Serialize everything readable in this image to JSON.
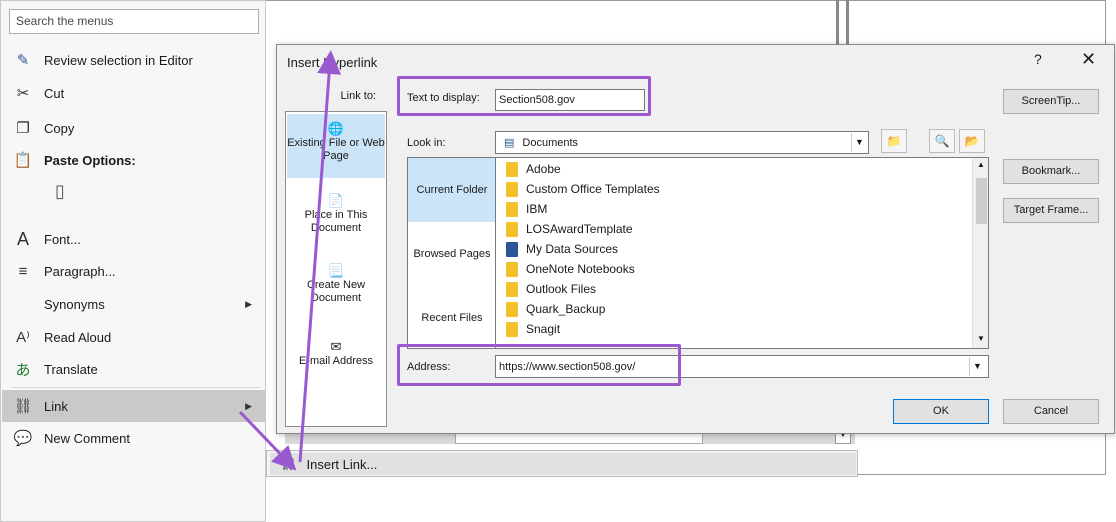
{
  "context_menu": {
    "search_placeholder": "Search the menus",
    "items": [
      {
        "label": "Review selection in Editor",
        "icon": "pen-icon"
      },
      {
        "label": "Cut",
        "icon": "scissors-icon"
      },
      {
        "label": "Copy",
        "icon": "copy-icon"
      },
      {
        "label": "Paste Options:",
        "icon": "paste-icon"
      },
      {
        "label": "Font...",
        "icon": "font-icon"
      },
      {
        "label": "Paragraph...",
        "icon": "paragraph-icon"
      },
      {
        "label": "Synonyms",
        "icon": ""
      },
      {
        "label": "Read Aloud",
        "icon": "read-aloud-icon"
      },
      {
        "label": "Translate",
        "icon": "translate-icon"
      },
      {
        "label": "Link",
        "icon": "link-icon"
      },
      {
        "label": "New Comment",
        "icon": "comment-icon"
      }
    ]
  },
  "submenu": {
    "insert_link": "Insert Link..."
  },
  "dialog": {
    "title": "Insert Hyperlink",
    "help": "?",
    "close": "✕",
    "link_to_label": "Link to:",
    "link_to_items": [
      {
        "label": "Existing File or Web Page"
      },
      {
        "label": "Place in This Document"
      },
      {
        "label": "Create New Document"
      },
      {
        "label": "E-mail Address"
      }
    ],
    "text_to_display_label": "Text to display:",
    "text_to_display_value": "Section508.gov",
    "screentip_button": "ScreenTip...",
    "look_in_label": "Look in:",
    "look_in_value": "Documents",
    "nav": [
      "Current Folder",
      "Browsed Pages",
      "Recent Files"
    ],
    "files": [
      "Adobe",
      "Custom Office Templates",
      "IBM",
      "LOSAwardTemplate",
      "My Data Sources",
      "OneNote Notebooks",
      "Outlook Files",
      "Quark_Backup",
      "Snagit"
    ],
    "bookmark_button": "Bookmark...",
    "target_frame_button": "Target Frame...",
    "address_label": "Address:",
    "address_value": "https://www.section508.gov/",
    "ok_button": "OK",
    "cancel_button": "Cancel"
  },
  "colors": {
    "annotation": "#9b59d0",
    "selection": "#cce4f7",
    "folder": "#f2c12e"
  }
}
